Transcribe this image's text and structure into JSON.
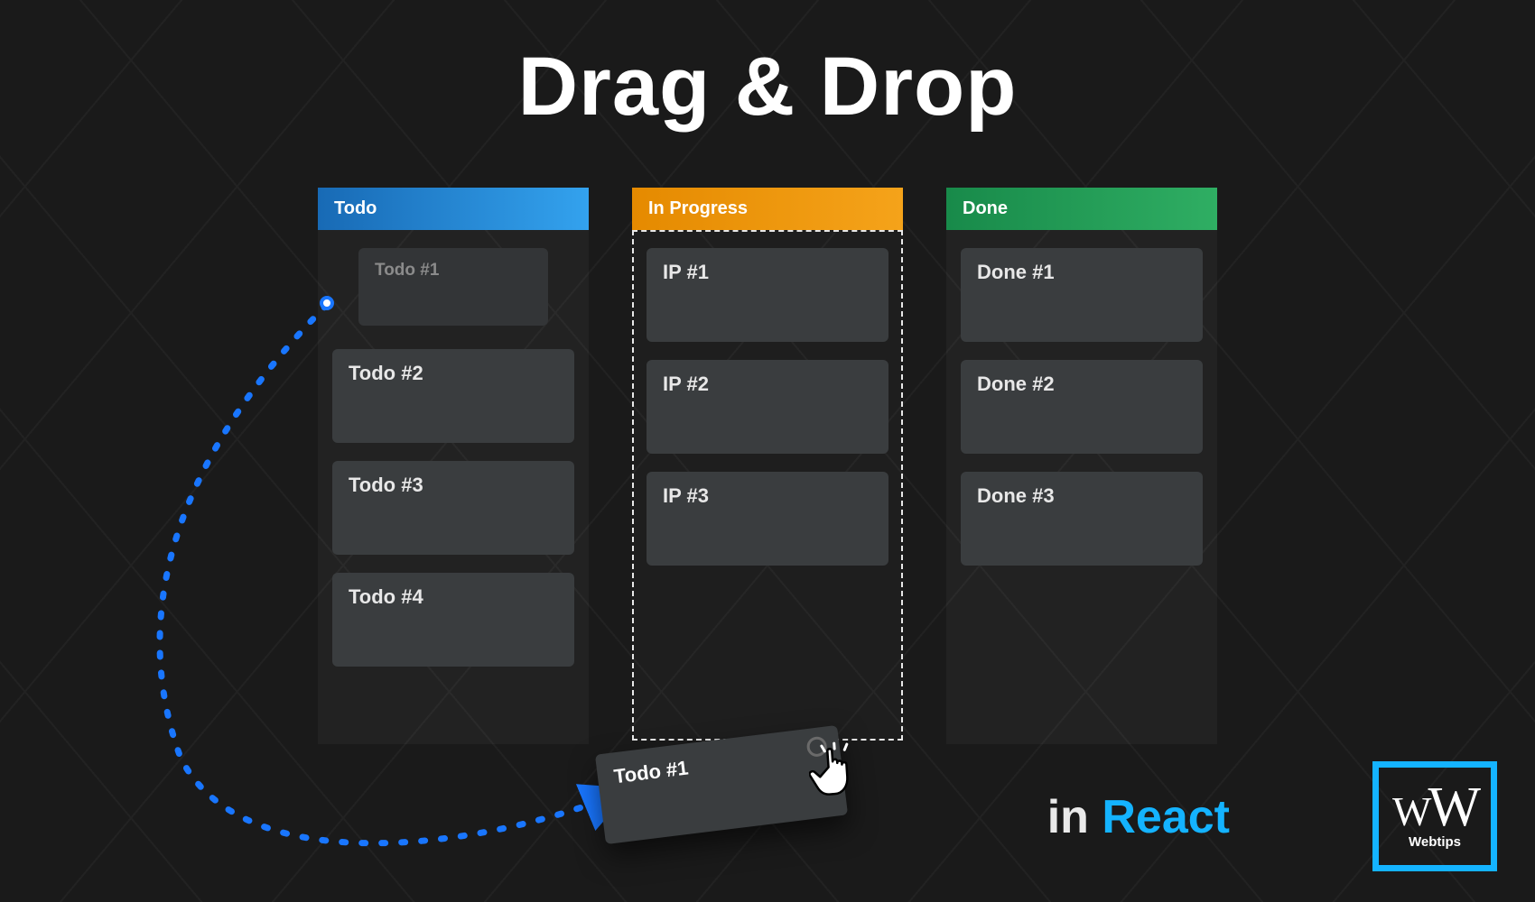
{
  "title": "Drag & Drop",
  "columns": [
    {
      "title": "Todo",
      "color": "blue",
      "ghost": "Todo #1",
      "cards": [
        "Todo #2",
        "Todo #3",
        "Todo #4"
      ]
    },
    {
      "title": "In Progress",
      "color": "orange",
      "dropTarget": true,
      "cards": [
        "IP #1",
        "IP #2",
        "IP #3"
      ]
    },
    {
      "title": "Done",
      "color": "green",
      "cards": [
        "Done #1",
        "Done #2",
        "Done #3"
      ]
    }
  ],
  "draggingCard": "Todo #1",
  "caption": {
    "prefix": "in",
    "highlight": "React"
  },
  "logo": {
    "mark": "WW",
    "text": "Webtips"
  },
  "colors": {
    "accentBlue": "#1976ff",
    "reactBlue": "#14b3ff",
    "cardBg": "#3a3d3f"
  }
}
